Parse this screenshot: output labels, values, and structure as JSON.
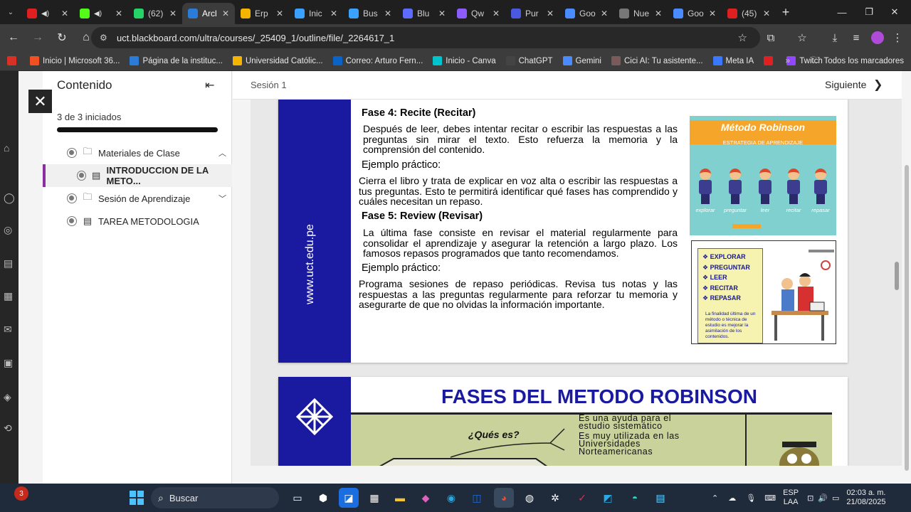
{
  "browser": {
    "tabs": [
      {
        "label": "",
        "color": "#e02020",
        "active": false,
        "audio": true
      },
      {
        "label": "",
        "color": "#53fc18",
        "active": false,
        "audio": true
      },
      {
        "label": "(62)",
        "color": "#25d366",
        "active": false,
        "audio": false
      },
      {
        "label": "Arcl",
        "color": "#2b7bd8",
        "active": true,
        "audio": false
      },
      {
        "label": "Erp",
        "color": "#f4b400",
        "active": false,
        "audio": false
      },
      {
        "label": "Inic",
        "color": "#3aa1ff",
        "active": false,
        "audio": false
      },
      {
        "label": "Bus",
        "color": "#3aa1ff",
        "active": false,
        "audio": false
      },
      {
        "label": "Blu",
        "color": "#5b6cff",
        "active": false,
        "audio": false
      },
      {
        "label": "Qw",
        "color": "#8c5cff",
        "active": false,
        "audio": false
      },
      {
        "label": "Pur",
        "color": "#4a59e0",
        "active": false,
        "audio": false
      },
      {
        "label": "Goo",
        "color": "#4a8cff",
        "active": false,
        "audio": false
      },
      {
        "label": "Nue",
        "color": "#777777",
        "active": false,
        "audio": false
      },
      {
        "label": "Goo",
        "color": "#4a8cff",
        "active": false,
        "audio": false
      },
      {
        "label": "(45)",
        "color": "#e02020",
        "active": false,
        "audio": false
      }
    ],
    "url": "uct.blackboard.com/ultra/courses/_25409_1/outline/file/_2264617_1",
    "bookmarks": [
      {
        "label": "",
        "color": "#d93025"
      },
      {
        "label": "Inicio | Microsoft 36...",
        "color": "#f25022"
      },
      {
        "label": "Página de la instituc...",
        "color": "#2b7bd8"
      },
      {
        "label": "Universidad Católic...",
        "color": "#f4b400"
      },
      {
        "label": "Correo: Arturo Fern...",
        "color": "#0a64c8"
      },
      {
        "label": "Inicio - Canva",
        "color": "#00c4cc"
      },
      {
        "label": "ChatGPT",
        "color": "#444444"
      },
      {
        "label": "Gemini",
        "color": "#4a8cff"
      },
      {
        "label": "Cici AI: Tu asistente...",
        "color": "#7a5a5a"
      },
      {
        "label": "Meta IA",
        "color": "#3a78ff"
      },
      {
        "label": "",
        "color": "#e02020"
      },
      {
        "label": "Twitch",
        "color": "#9146ff"
      }
    ],
    "all_bookmarks": "Todos los marcadores"
  },
  "outline": {
    "title": "Contenido",
    "progress_text": "3 de 3 iniciados",
    "progress": 1.0,
    "items": [
      {
        "label": "Materiales de Clase",
        "icon": "folder-icon",
        "expanded": true,
        "selected": false
      },
      {
        "label": "INTRODUCCION DE LA METO...",
        "icon": "document-icon",
        "expanded": null,
        "selected": true
      },
      {
        "label": "Sesión de Aprendizaje",
        "icon": "folder-icon",
        "expanded": false,
        "selected": false
      },
      {
        "label": "TAREA METODOLOGIA",
        "icon": "document-icon",
        "expanded": null,
        "selected": false
      }
    ]
  },
  "content": {
    "session": "Sesión 1",
    "next": "Siguiente"
  },
  "slide1": {
    "website": "www.uct.edu.pe",
    "fase4_title": "Fase 4: Recite (Recitar)",
    "fase4_text": "Después de leer, debes intentar recitar o escribir las respuestas a las preguntas sin mirar el texto. Esto refuerza la memoria y la comprensión del contenido.",
    "ejemplo1_label": "Ejemplo práctico:",
    "ejemplo1_text": "Cierra el libro y trata de explicar en voz alta o escribir las respuestas a tus preguntas. Esto te permitirá identificar qué fases has comprendido y cuáles necesitan un repaso.",
    "fase5_title": "Fase 5: Review (Revisar)",
    "fase5_text": "La última fase consiste en revisar el material regularmente para consolidar el aprendizaje y asegurar la retención a largo plazo. Los famosos repasos programados que tanto recomendamos.",
    "ejemplo2_label": "Ejemplo práctico:",
    "ejemplo2_text": "Programa sesiones de repaso periódicas. Revisa tus notas y las respuestas a las preguntas regularmente para reforzar tu memoria y asegurarte de que no olvidas la información importante.",
    "img1": {
      "title": "Método Robinson",
      "subtitle": "ESTRATEGIA DE APRENDIZAJE",
      "steps": [
        "explorar",
        "preguntar",
        "leer",
        "recitar",
        "repasar"
      ]
    },
    "img2": {
      "steps": [
        "EXPLORAR",
        "PREGUNTAR",
        "LEER",
        "RECITAR",
        "REPASAR"
      ],
      "description": "La finalidad última de un método o técnica de estudio es mejorar la asimilación de los contenidos."
    }
  },
  "slide2": {
    "title": "FASES DEL METODO ROBINSON",
    "question": "¿Qués es?",
    "lines": [
      "Es una ayuda para el",
      "estudio sistemático",
      "Es muy utilizada en las",
      "Universidades",
      "Norteamericanas"
    ]
  },
  "taskbar": {
    "search_placeholder": "Buscar",
    "badge": "3",
    "lang1": "ESP",
    "lang2": "LAA",
    "time": "02:03 a. m.",
    "date": "21/08/2025"
  },
  "colors": {
    "brand_blue": "#1a1aa0",
    "selected_accent": "#8b2ea0"
  }
}
